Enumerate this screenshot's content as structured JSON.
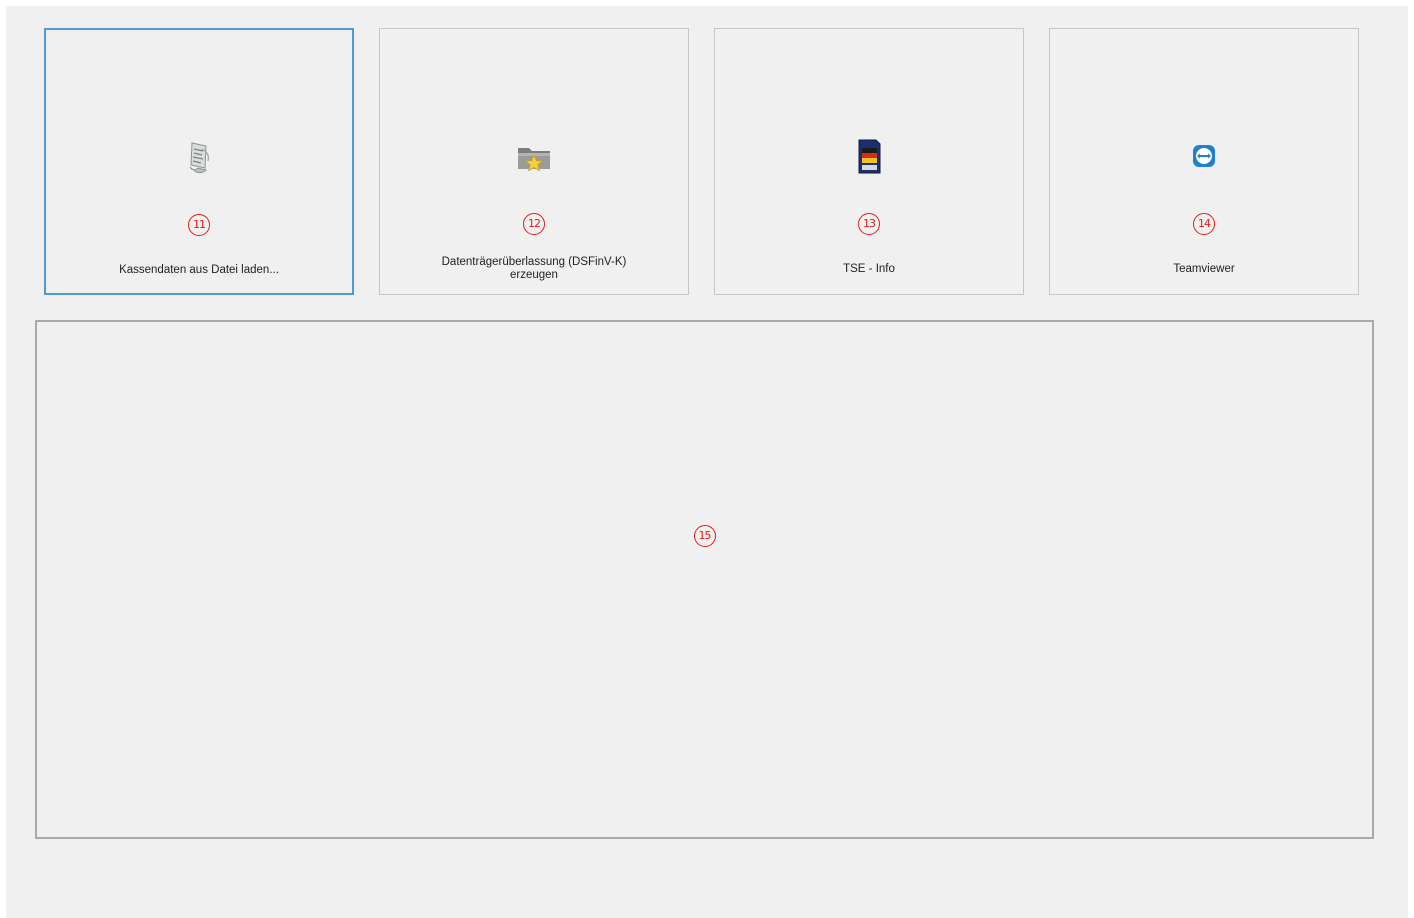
{
  "toolbar": {
    "tiles": [
      {
        "label": "Kassendaten aus Datei laden...",
        "marker": "11",
        "icon": "document-scroll-icon"
      },
      {
        "label": "Datenträgerüberlassung (DSFinV-K)\nerzeugen",
        "marker": "12",
        "icon": "folder-star-icon"
      },
      {
        "label": "TSE - Info",
        "marker": "13",
        "icon": "sd-card-icon"
      },
      {
        "label": "Teamviewer",
        "marker": "14",
        "icon": "teamviewer-icon"
      }
    ]
  },
  "content_panel": {
    "marker": "15"
  },
  "colors": {
    "background": "#f0f0f0",
    "selected_border": "#4e9bd8",
    "marker_red": "#e41b1b",
    "teamviewer_blue": "#1e7fd4"
  }
}
